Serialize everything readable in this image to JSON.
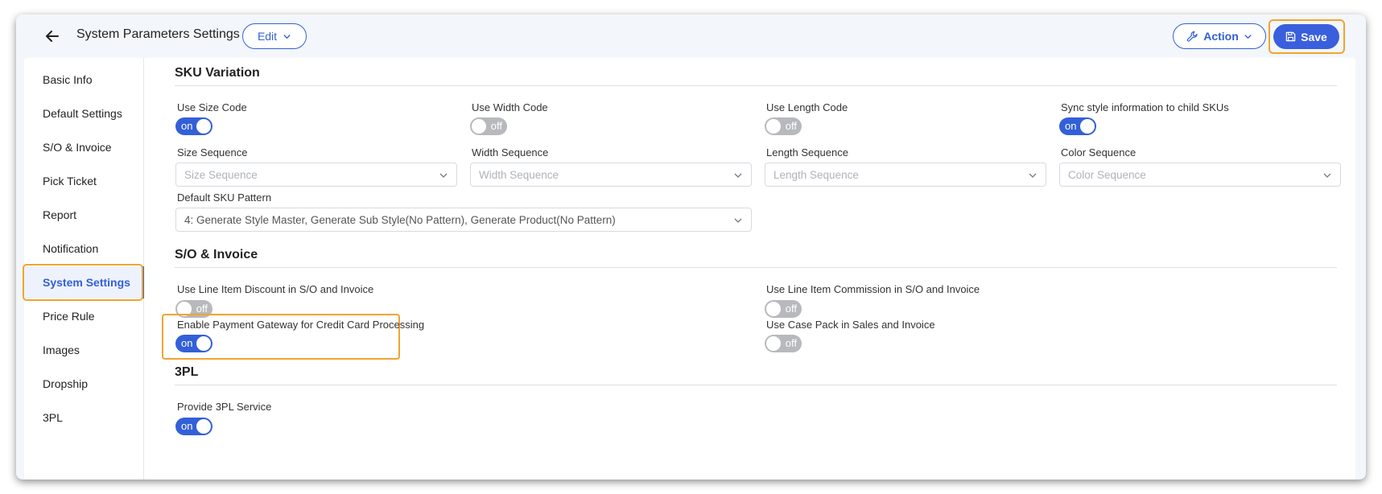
{
  "header": {
    "title": "System Parameters Settings",
    "edit_label": "Edit",
    "action_label": "Action",
    "save_label": "Save"
  },
  "sidebar": {
    "items": [
      {
        "label": "Basic Info"
      },
      {
        "label": "Default Settings"
      },
      {
        "label": "S/O & Invoice"
      },
      {
        "label": "Pick Ticket"
      },
      {
        "label": "Report"
      },
      {
        "label": "Notification"
      },
      {
        "label": "System Settings",
        "active": true
      },
      {
        "label": "Price Rule"
      },
      {
        "label": "Images"
      },
      {
        "label": "Dropship"
      },
      {
        "label": "3PL"
      }
    ]
  },
  "sku_variation": {
    "title": "SKU Variation",
    "use_size_code": {
      "label": "Use Size Code",
      "state": "on"
    },
    "use_width_code": {
      "label": "Use Width Code",
      "state": "off"
    },
    "use_length_code": {
      "label": "Use Length Code",
      "state": "off"
    },
    "sync_style": {
      "label": "Sync style information to child SKUs",
      "state": "on"
    },
    "size_sequence": {
      "label": "Size Sequence",
      "placeholder": "Size Sequence"
    },
    "width_sequence": {
      "label": "Width Sequence",
      "placeholder": "Width Sequence"
    },
    "length_sequence": {
      "label": "Length Sequence",
      "placeholder": "Length Sequence"
    },
    "color_sequence": {
      "label": "Color Sequence",
      "placeholder": "Color Sequence"
    },
    "default_sku_pattern": {
      "label": "Default SKU Pattern",
      "value": "4: Generate Style Master, Generate Sub Style(No Pattern), Generate Product(No Pattern)"
    }
  },
  "so_invoice": {
    "title": "S/O & Invoice",
    "line_item_discount": {
      "label": "Use Line Item Discount in S/O and Invoice",
      "state": "off"
    },
    "line_item_commission": {
      "label": "Use Line Item Commission in S/O and Invoice",
      "state": "off"
    },
    "payment_gateway": {
      "label": "Enable Payment Gateway for Credit Card Processing",
      "state": "on"
    },
    "case_pack": {
      "label": "Use Case Pack in Sales and Invoice",
      "state": "off"
    }
  },
  "tpl": {
    "title": "3PL",
    "provide_service": {
      "label": "Provide 3PL Service",
      "state": "on"
    }
  },
  "colors": {
    "accent": "#3360d8",
    "highlight": "#f0a431",
    "toggle_off": "#b7b9bd"
  }
}
